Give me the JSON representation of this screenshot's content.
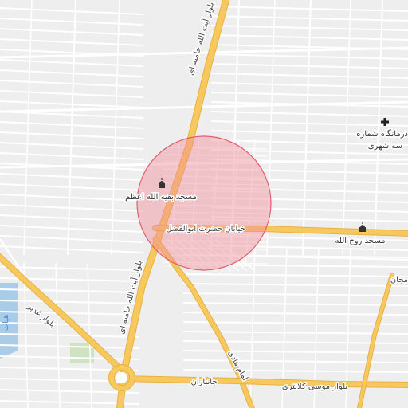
{
  "map": {
    "search_radius_circle": {
      "fill": "#f08c96",
      "stroke": "#e0606e"
    },
    "colors": {
      "background": "#eeeeee",
      "minor_road": "#ffffff",
      "major_road": "#f7c95d",
      "major_road_casing": "#e7b048",
      "water": "#a9cde9",
      "park": "#cfe3c2"
    },
    "pois": [
      {
        "name": "مسجد بقیه الله اعظم",
        "icon": "mosque-icon"
      },
      {
        "name": "مسجد روح الله",
        "icon": "mosque-icon"
      },
      {
        "name": "درمانگاه شماره",
        "name_line2": "سه شهری",
        "icon": "clinic-cross-icon"
      }
    ],
    "roads": {
      "ayatollah_khamenei_north": "بلوار آیت الله خامنه ای",
      "ayatollah_khamenei_south": "بلوار آیت الله خامنه ای",
      "hazrat_abolfazl": "خیابان حضرت ابوالفضل",
      "ghadir": "بلوار غدیر",
      "janbazan": "جانبازان",
      "imam_hadi": "امام هادی",
      "musa_kalantari": "بلوار موسی کلانتری",
      "right_edge": "مجان"
    },
    "water_label": "هیات"
  }
}
